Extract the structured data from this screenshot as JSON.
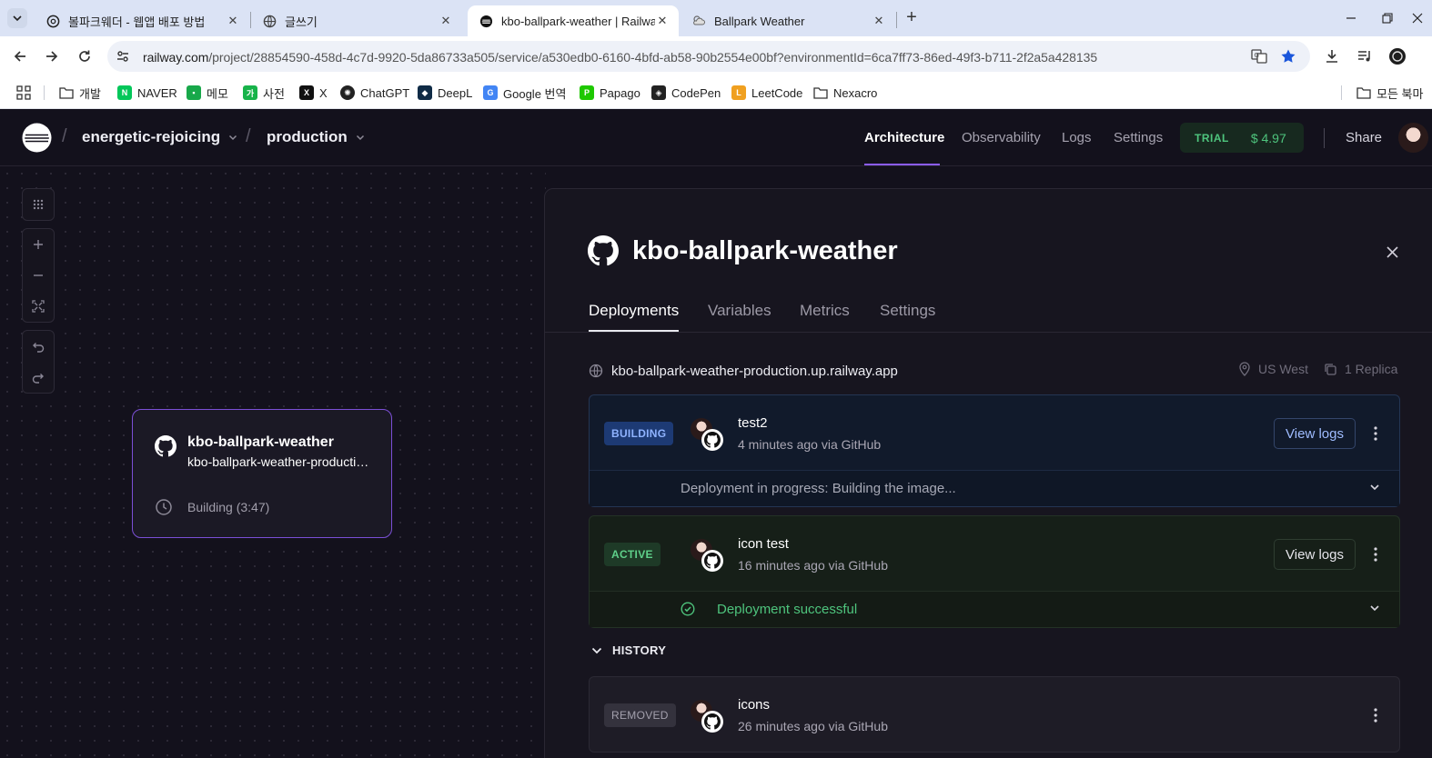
{
  "browser": {
    "tabs": [
      {
        "title": "볼파크웨더 - 웹앱 배포 방법",
        "icon": "chatgpt-icon"
      },
      {
        "title": "글쓰기",
        "icon": "globe-icon"
      },
      {
        "title": "kbo-ballpark-weather | Railway",
        "icon": "railway-icon",
        "active": true
      },
      {
        "title": "Ballpark Weather",
        "icon": "weather-icon"
      }
    ],
    "url_host": "railway.com",
    "url_path": "/project/28854590-458d-4c7d-9920-5da86733a505/service/a530edb0-6160-4bfd-ab58-90b2554e00bf?environmentId=6ca7ff73-86ed-49f3-b711-2f2a5a428135",
    "bookmarks": [
      {
        "label": "개발",
        "icon": "folder-icon"
      },
      {
        "label": "NAVER",
        "icon": "naver-icon",
        "glyph": "N",
        "color": "#03c75a"
      },
      {
        "label": "메모",
        "icon": "memo-icon",
        "glyph": "▪",
        "color": "#18a84a"
      },
      {
        "label": "사전",
        "icon": "dictionary-icon",
        "glyph": "가",
        "color": "#18b34a"
      },
      {
        "label": "X",
        "icon": "x-icon",
        "glyph": "X",
        "color": "#111111"
      },
      {
        "label": "ChatGPT",
        "icon": "chatgpt-icon",
        "glyph": "✺",
        "color": "#222222"
      },
      {
        "label": "DeepL",
        "icon": "deepl-icon",
        "glyph": "◆",
        "color": "#0f2b46"
      },
      {
        "label": "Google 번역",
        "icon": "google-translate-icon",
        "glyph": "G",
        "color": "#4285f4"
      },
      {
        "label": "Papago",
        "icon": "papago-icon",
        "glyph": "P",
        "color": "#1ec800"
      },
      {
        "label": "CodePen",
        "icon": "codepen-icon",
        "glyph": "◈",
        "color": "#222222"
      },
      {
        "label": "LeetCode",
        "icon": "leetcode-icon",
        "glyph": "L",
        "color": "#f0a020"
      },
      {
        "label": "Nexacro",
        "icon": "folder-icon"
      }
    ],
    "bookmarks_overflow": "모든 북마"
  },
  "app": {
    "project": "energetic-rejoicing",
    "environment": "production",
    "nav": [
      "Architecture",
      "Observability",
      "Logs",
      "Settings"
    ],
    "trial_label": "TRIAL",
    "trial_amount": "$ 4.97",
    "share": "Share"
  },
  "canvas": {
    "service_card": {
      "name": "kbo-ballpark-weather",
      "url": "kbo-ballpark-weather-production.up.railway.app",
      "status": "Building (3:47)"
    }
  },
  "panel": {
    "title": "kbo-ballpark-weather",
    "tabs": [
      "Deployments",
      "Variables",
      "Metrics",
      "Settings"
    ],
    "domain": "kbo-ballpark-weather-production.up.railway.app",
    "region": "US West",
    "replicas": "1 Replica",
    "deployments": [
      {
        "badge": "BUILDING",
        "message": "test2",
        "meta": "4 minutes ago via GitHub",
        "action": "View logs",
        "status": "Deployment in progress:  Building the image..."
      },
      {
        "badge": "ACTIVE",
        "message": "icon test",
        "meta": "16 minutes ago via GitHub",
        "action": "View logs",
        "status": "Deployment successful"
      }
    ],
    "history_label": "HISTORY",
    "history": [
      {
        "badge": "REMOVED",
        "message": "icons",
        "meta": "26 minutes ago via GitHub"
      }
    ]
  },
  "colors": {
    "accent": "#8b5cf6",
    "building": "#4f7fe6",
    "active": "#4ec47d",
    "removed": "#8f8c98"
  }
}
